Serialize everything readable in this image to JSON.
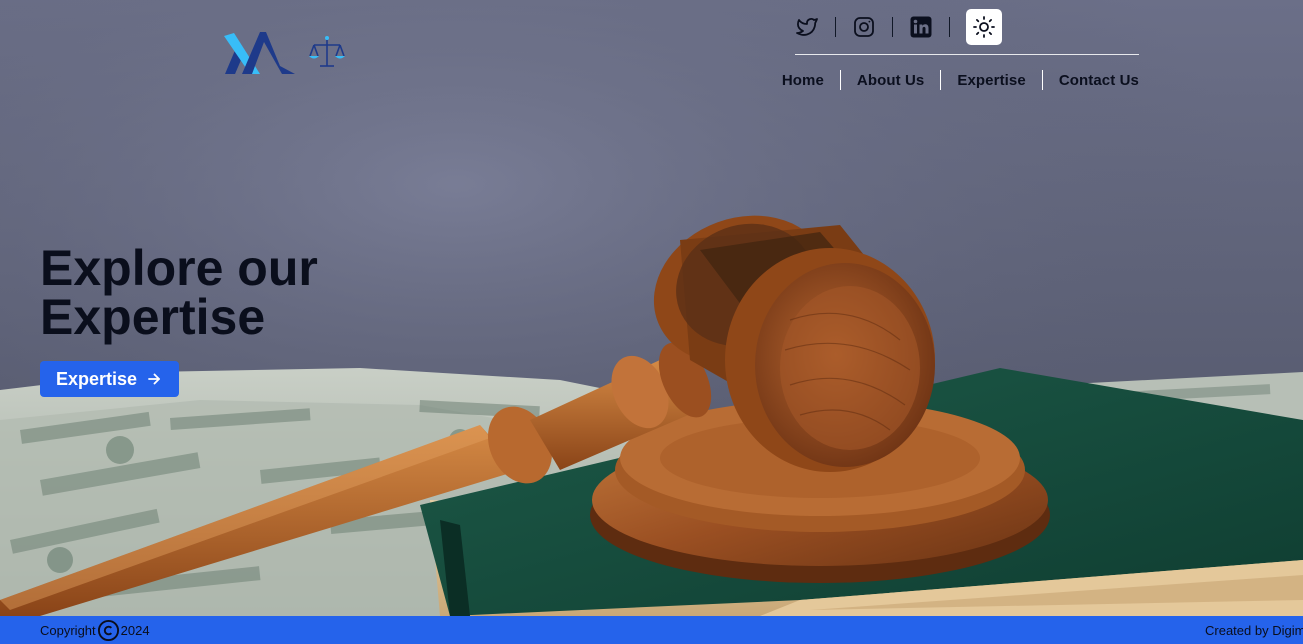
{
  "header": {
    "social": [
      "twitter-icon",
      "instagram-icon",
      "linkedin-icon"
    ],
    "theme_toggle_icon": "sun-icon"
  },
  "nav": {
    "items": [
      {
        "label": "Home"
      },
      {
        "label": "About Us"
      },
      {
        "label": "Expertise"
      },
      {
        "label": "Contact Us"
      }
    ]
  },
  "hero": {
    "title_line1": "Explore our",
    "title_line2": "Expertise",
    "button_label": "Expertise"
  },
  "footer": {
    "copyright_prefix": "Copyright",
    "year": "2024",
    "credit": "Created by Digim"
  },
  "colors": {
    "accent": "#2563eb",
    "text_dark": "#0a0e1c",
    "logo_dark": "#1e3a8a",
    "logo_light": "#38bdf8"
  }
}
